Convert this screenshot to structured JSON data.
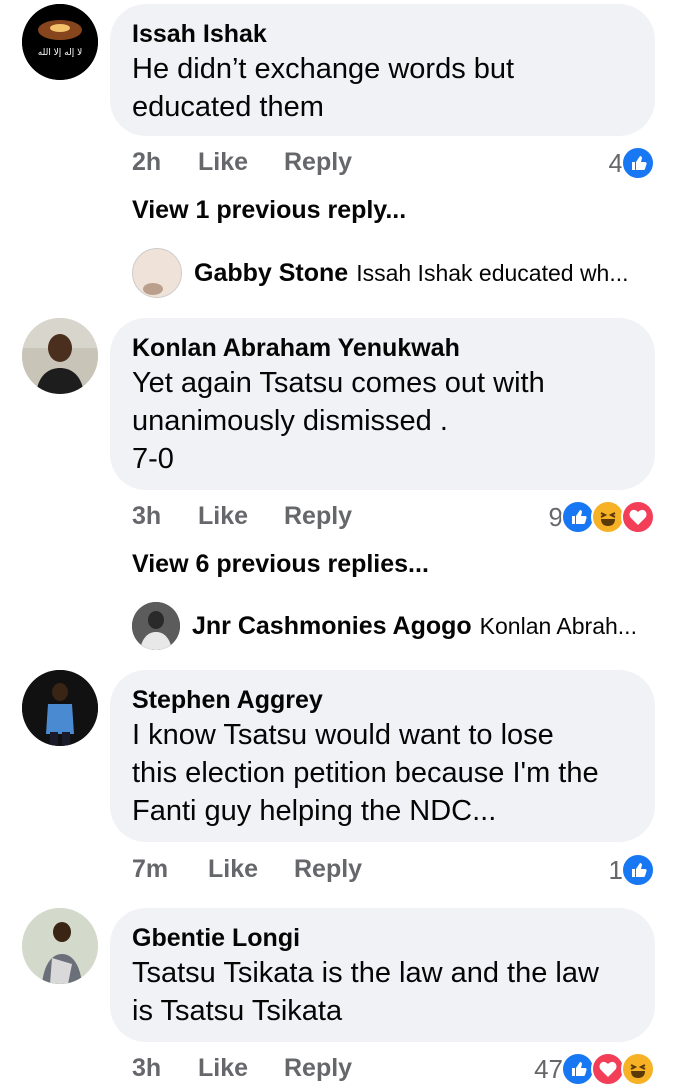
{
  "comments": [
    {
      "name": "Issah Ishak",
      "avatar_text": "لا إله إلا الله",
      "lines": [
        "He didn’t exchange words but",
        "educated them"
      ],
      "time": "2h",
      "like": "Like",
      "reply": "Reply",
      "reaction_count": "4",
      "reactions": [
        "like-icon"
      ],
      "view_replies": "View 1 previous reply...",
      "reply_preview": {
        "name": "Gabby Stone",
        "text": "Issah Ishak  educated wh..."
      }
    },
    {
      "name": "Konlan Abraham Yenukwah",
      "lines": [
        "Yet again Tsatsu comes out with",
        "unanimously dismissed .",
        "7-0"
      ],
      "time": "3h",
      "like": "Like",
      "reply": "Reply",
      "reaction_count": "9",
      "reactions": [
        "like-icon",
        "haha-icon",
        "love-icon"
      ],
      "view_replies": "View 6 previous replies...",
      "reply_preview": {
        "name": "Jnr Cashmonies Agogo",
        "text": "Konlan Abrah..."
      }
    },
    {
      "name": "Stephen Aggrey",
      "lines": [
        "I know Tsatsu would want to lose",
        "this election petition because I'm the",
        "Fanti guy helping the NDC..."
      ],
      "time": "7m",
      "like": "Like",
      "reply": "Reply",
      "reaction_count": "1",
      "reactions": [
        "like-icon"
      ]
    },
    {
      "name": "Gbentie Longi",
      "lines": [
        "Tsatsu Tsikata is the law and the law",
        "is Tsatsu Tsikata"
      ],
      "time": "3h",
      "like": "Like",
      "reply": "Reply",
      "reaction_count": "47",
      "reactions": [
        "like-icon",
        "love-icon",
        "haha-icon"
      ]
    }
  ],
  "colors": {
    "like": "#1877f2",
    "love": "#f33e58",
    "haha": "#f7b125",
    "bubble": "#f0f2f5",
    "meta": "#65676b"
  }
}
